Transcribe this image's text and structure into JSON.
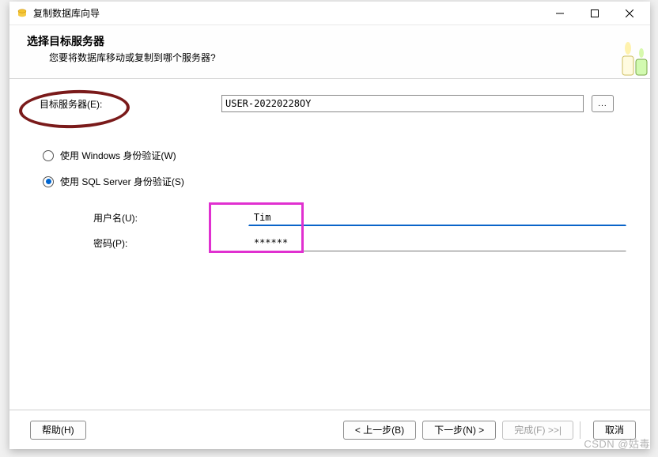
{
  "titlebar": {
    "title": "复制数据库向导"
  },
  "header": {
    "title": "选择目标服务器",
    "subtitle": "您要将数据库移动或复制到哪个服务器?"
  },
  "form": {
    "target_server_label": "目标服务器(E):",
    "target_server_value": "USER-20220228OY",
    "browse_label": "...",
    "auth_windows": "使用 Windows 身份验证(W)",
    "auth_sqlserver": "使用 SQL Server 身份验证(S)",
    "username_label": "用户名(U):",
    "username_value": "Tim",
    "password_label": "密码(P):",
    "password_value": "******"
  },
  "footer": {
    "help": "帮助(H)",
    "back": "< 上一步(B)",
    "next": "下一步(N) >",
    "finish": "完成(F) >>|",
    "cancel": "取消"
  },
  "watermark": "CSDN @姑毒"
}
